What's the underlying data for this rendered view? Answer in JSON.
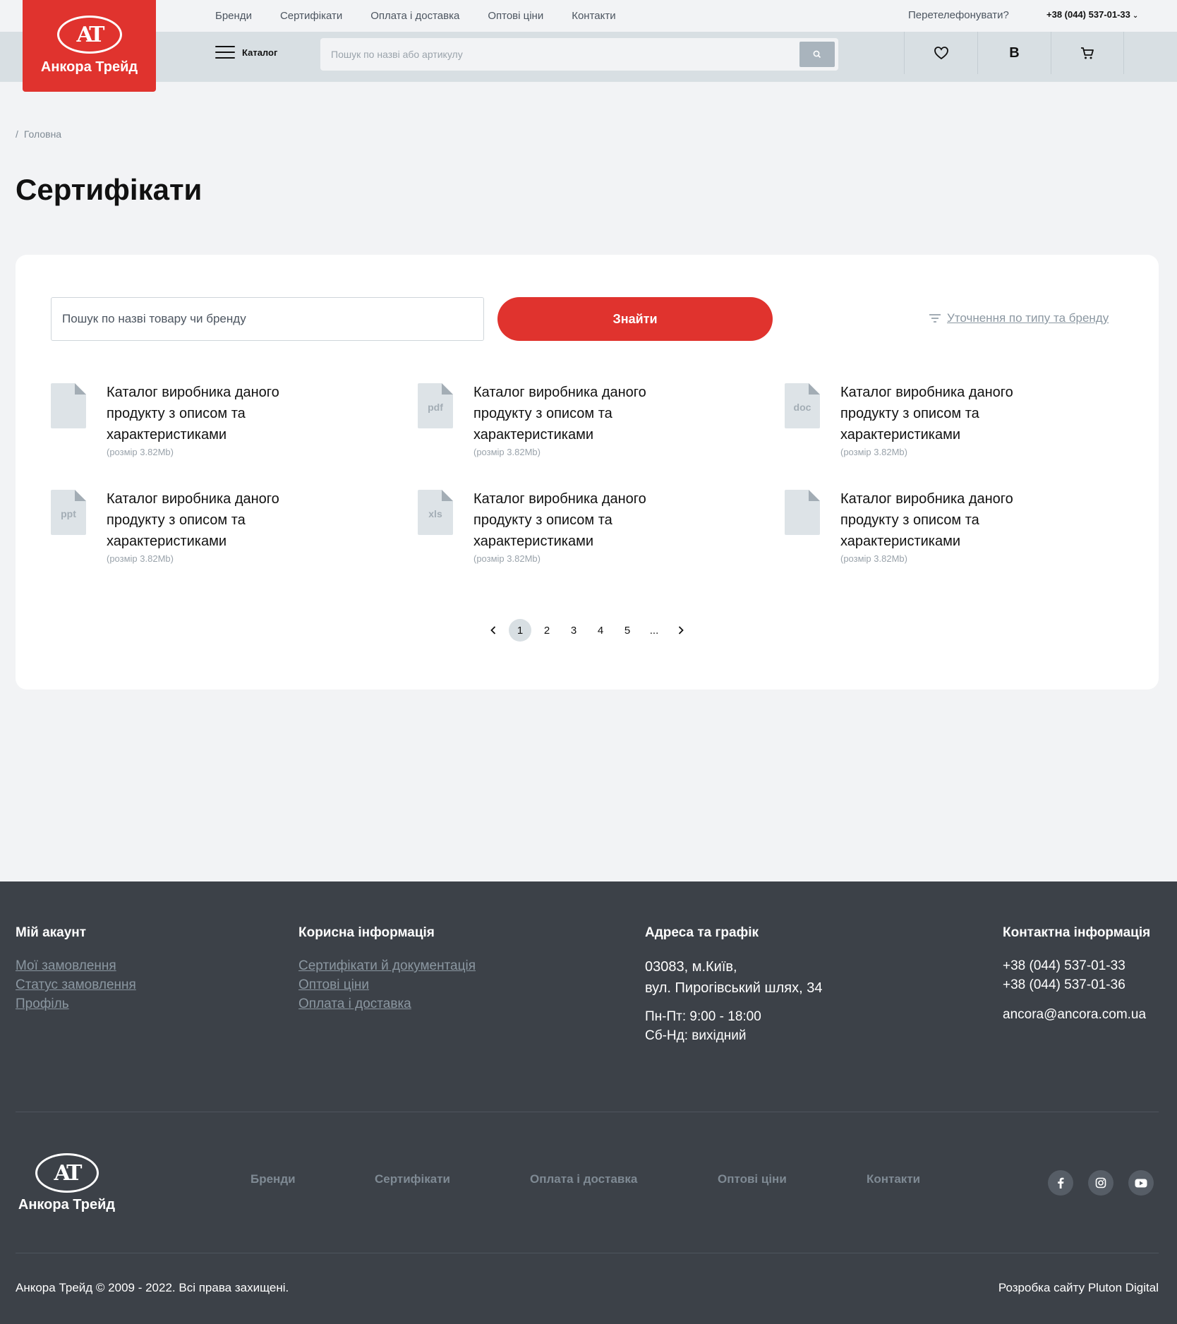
{
  "header": {
    "top_nav": [
      "Бренди",
      "Сертифікати",
      "Оплата і доставка",
      "Оптові ціни",
      "Контакти"
    ],
    "callback_label": "Перетелефонувати?",
    "phone": "+38 (044) 537-01-33",
    "logo_text": "Анкора Трейд",
    "catalog_label": "Каталог",
    "search_placeholder": "Пошук по назві або артикулу",
    "account_letter": "B"
  },
  "breadcrumb": {
    "separator": "/",
    "home": "Головна"
  },
  "page_title": "Сертифікати",
  "filters": {
    "search_placeholder": "Пошук по назві товару чи бренду",
    "find_button": "Знайти",
    "refine_link": "Уточнення по типу та бренду"
  },
  "files": [
    {
      "name": "Каталог виробника даного продукту з описом та характеристиками",
      "size": "(розмір 3.82Mb)",
      "ext": ""
    },
    {
      "name": "Каталог виробника даного продукту з описом та характеристиками",
      "size": "(розмір 3.82Mb)",
      "ext": "pdf"
    },
    {
      "name": "Каталог виробника даного продукту з описом та характеристиками",
      "size": "(розмір 3.82Mb)",
      "ext": "doc"
    },
    {
      "name": "Каталог виробника даного продукту з описом та характеристиками",
      "size": "(розмір 3.82Mb)",
      "ext": "ppt"
    },
    {
      "name": "Каталог виробника даного продукту з описом та характеристиками",
      "size": "(розмір 3.82Mb)",
      "ext": "xls"
    },
    {
      "name": "Каталог виробника даного продукту з описом та характеристиками",
      "size": "(розмір 3.82Mb)",
      "ext": ""
    }
  ],
  "pagination": {
    "pages": [
      "1",
      "2",
      "3",
      "4",
      "5",
      "..."
    ],
    "current": "1"
  },
  "footer": {
    "account": {
      "title": "Мій акаунт",
      "links": [
        "Мої замовлення",
        "Статус замовлення",
        "Профіль"
      ]
    },
    "info": {
      "title": "Корисна інформація",
      "links": [
        "Сертифікати й документація",
        "Оптові ціни",
        "Оплата і доставка"
      ]
    },
    "address": {
      "title": "Адреса та графік",
      "line1": "03083, м.Київ,",
      "line2": "вул. Пирогівський шлях, 34",
      "hours1": "Пн-Пт: 9:00 - 18:00",
      "hours2": "Сб-Нд: вихідний"
    },
    "contacts": {
      "title": "Контактна інформація",
      "phone1": "+38 (044) 537-01-33",
      "phone2": "+38 (044) 537-01-36",
      "email": "ancora@ancora.com.ua"
    },
    "logo_text": "Анкора Трейд",
    "nav": [
      "Бренди",
      "Сертифікати",
      "Оплата і доставка",
      "Оптові ціни",
      "Контакти"
    ],
    "social": [
      "facebook-icon",
      "instagram-icon",
      "youtube-icon"
    ],
    "copyright": "Анкора Трейд © 2009 - 2022. Всі права захищені.",
    "developer": "Розробка сайту Pluton Digital"
  },
  "colors": {
    "accent": "#e0332e",
    "footer_bg": "#3c4148",
    "header_bg": "#d8dfe3",
    "page_bg": "#f2f3f5"
  }
}
